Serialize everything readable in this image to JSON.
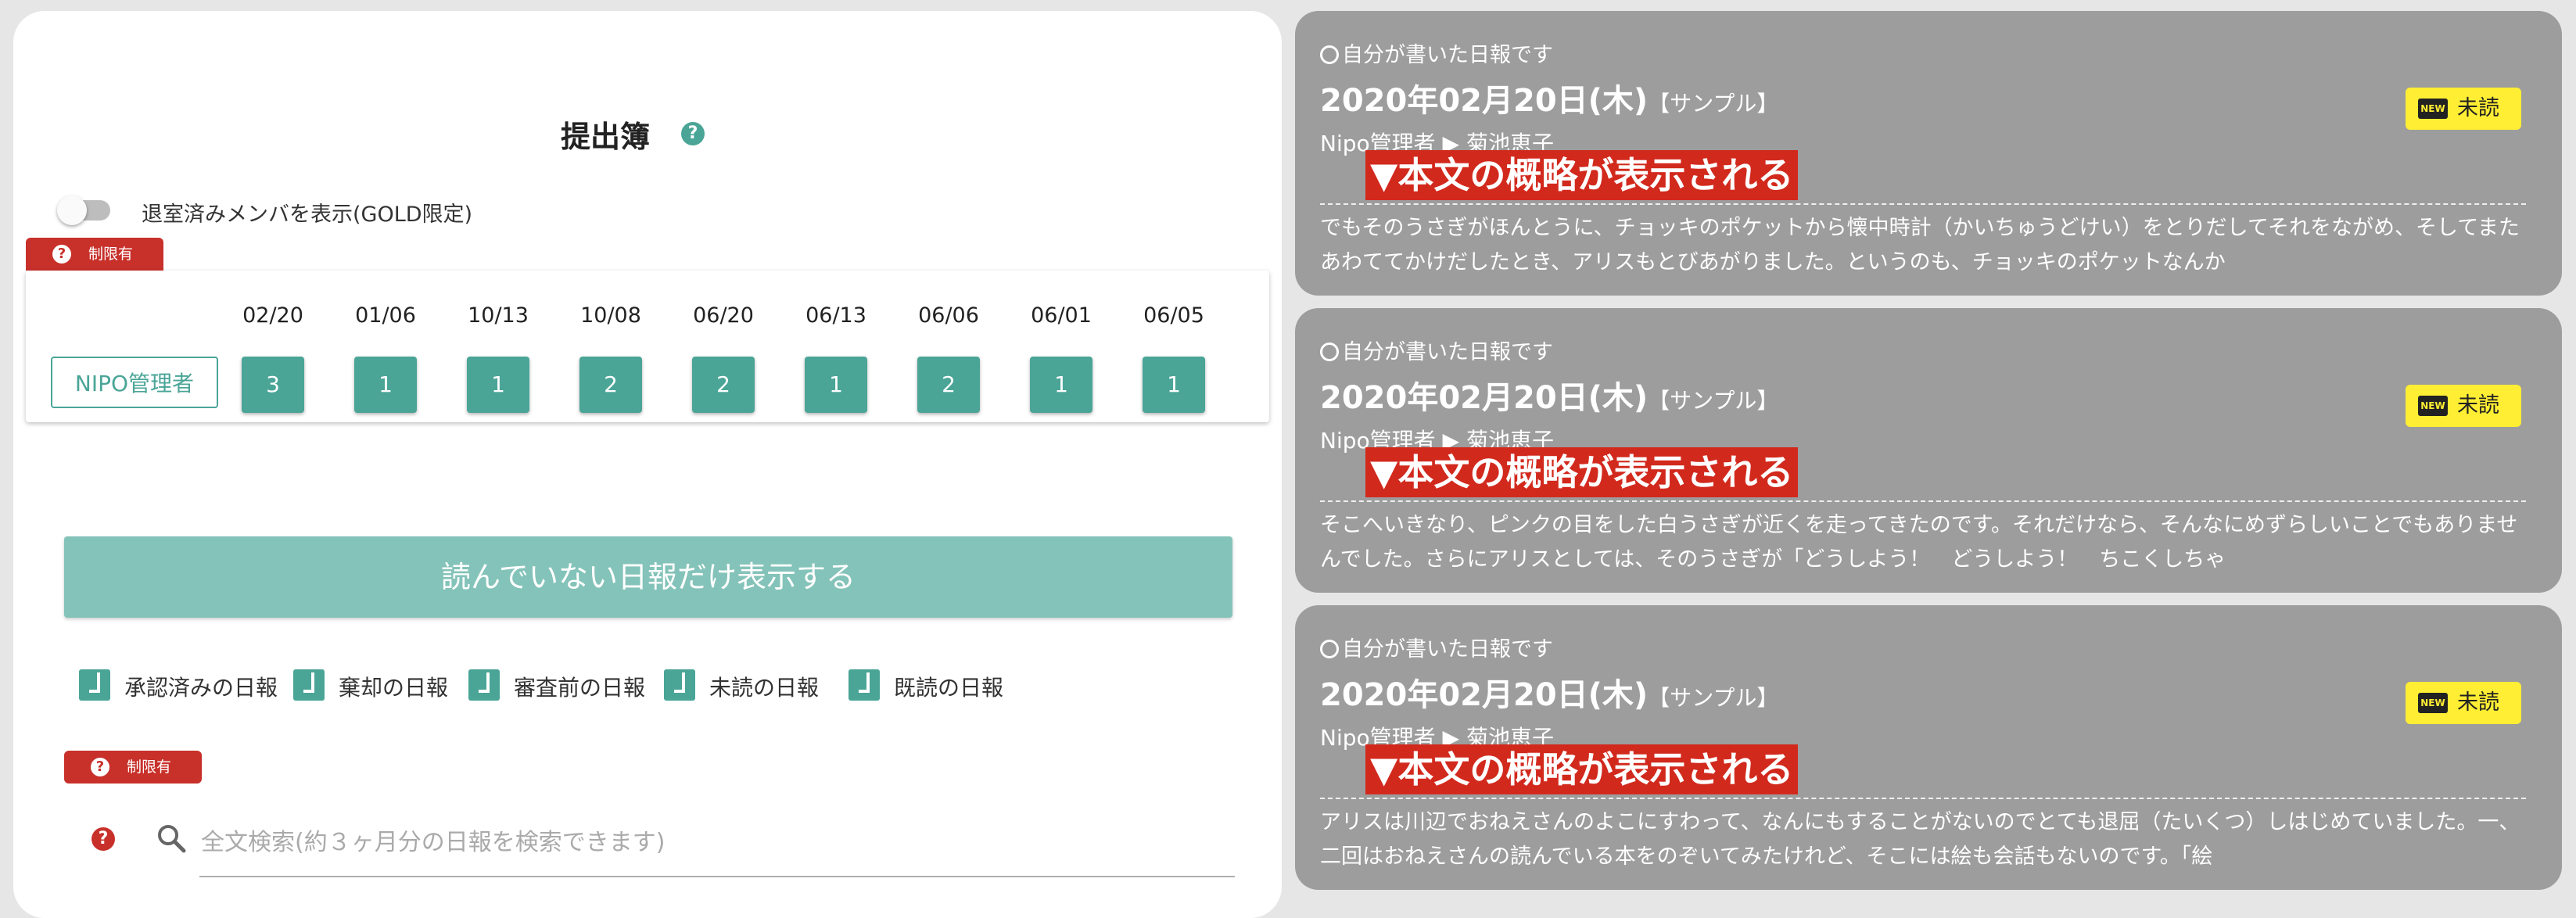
{
  "left": {
    "title": "提出簿",
    "help_glyph": "?",
    "toggle_label": "退室済みメンバを表示(GOLD限定)",
    "limit_badge": "制限有",
    "dates": [
      "02/20",
      "01/06",
      "10/13",
      "10/08",
      "06/20",
      "06/13",
      "06/06",
      "06/01",
      "06/05"
    ],
    "member": "NIPO管理者",
    "counts": [
      "3",
      "1",
      "1",
      "2",
      "2",
      "1",
      "2",
      "1",
      "1"
    ],
    "unread_button": "読んでいない日報だけ表示する",
    "filters": [
      "承認済みの日報",
      "棄却の日報",
      "審査前の日報",
      "未読の日報",
      "既読の日報"
    ],
    "search": {
      "placeholder": "全文検索(約３ヶ月分の日報を検索できます)",
      "help_glyph": "?"
    }
  },
  "reports": [
    {
      "own_label": "自分が書いた日報です",
      "date": "2020年02月20日(木)",
      "sample": "【サンプル】",
      "author": "Nipo管理者",
      "recipient": "菊池恵子",
      "route_arrow": "▶",
      "summary_highlight": "▼本文の概略が表示される",
      "body": "でもそのうさぎがほんとうに、チョッキのポケットから懐中時計（かいちゅうどけい）をとりだしてそれをながめ、そしてまたあわててかけだしたとき、アリスもとびあがりました。というのも、チョッキのポケットなんか",
      "new_tag": "NEW",
      "unread_label": "未読"
    },
    {
      "own_label": "自分が書いた日報です",
      "date": "2020年02月20日(木)",
      "sample": "【サンプル】",
      "author": "Nipo管理者",
      "recipient": "菊池恵子",
      "route_arrow": "▶",
      "summary_highlight": "▼本文の概略が表示される",
      "body": "そこへいきなり、ピンクの目をした白うさぎが近くを走ってきたのです。それだけなら、そんなにめずらしいことでもありませんでした。さらにアリスとしては、そのうさぎが「どうしよう！　どうしよう！　ちこくしちゃ",
      "new_tag": "NEW",
      "unread_label": "未読"
    },
    {
      "own_label": "自分が書いた日報です",
      "date": "2020年02月20日(木)",
      "sample": "【サンプル】",
      "author": "Nipo管理者",
      "recipient": "菊池恵子",
      "route_arrow": "▶",
      "summary_highlight": "▼本文の概略が表示される",
      "body": "アリスは川辺でおねえさんのよこにすわって、なんにもすることがないのでとても退屈（たいくつ）しはじめていました。一、二回はおねえさんの読んでいる本をのぞいてみたけれど、そこには絵も会話もないのです。「絵",
      "new_tag": "NEW",
      "unread_label": "未読"
    }
  ],
  "colors": {
    "accent": "#4aa597",
    "accent_light": "#84c3b9",
    "limit_red": "#c8302a",
    "card_gray": "#9d9d9d",
    "highlight_red": "#d2291d",
    "unread_yellow": "#ffee33"
  }
}
